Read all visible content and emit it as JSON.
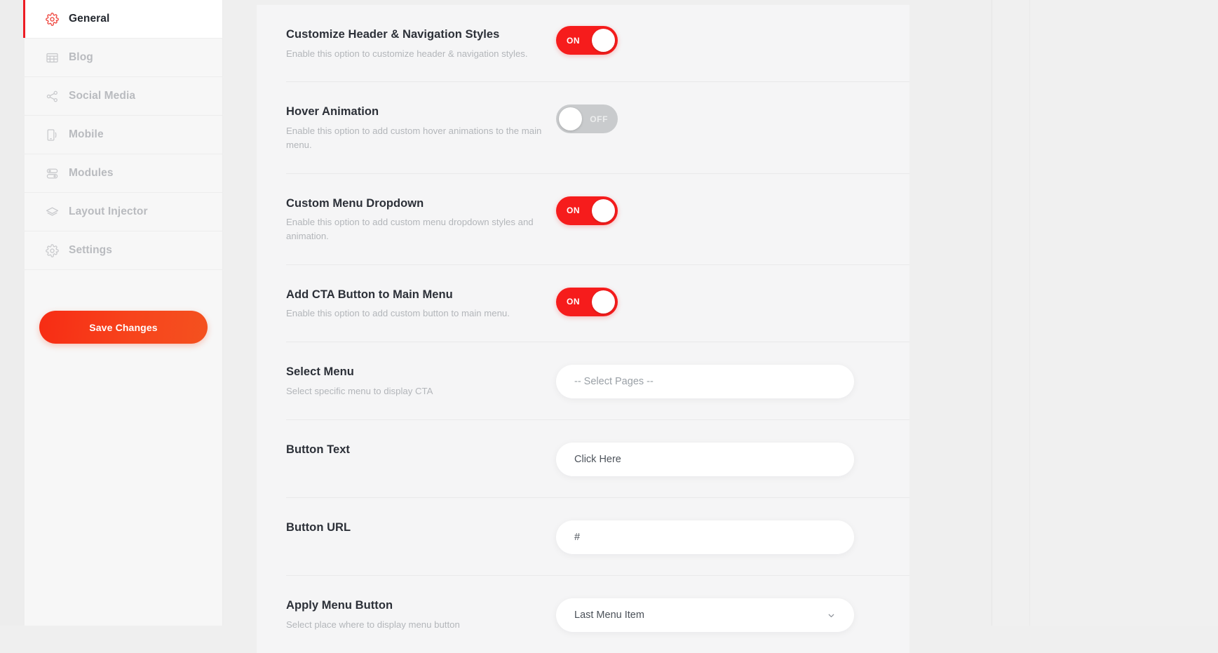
{
  "sidebar": {
    "items": [
      {
        "label": "General",
        "icon": "gear-icon",
        "active": true
      },
      {
        "label": "Blog",
        "icon": "blog-grid-icon",
        "active": false
      },
      {
        "label": "Social Media",
        "icon": "share-nodes-icon",
        "active": false
      },
      {
        "label": "Mobile",
        "icon": "mobile-device-icon",
        "active": false
      },
      {
        "label": "Modules",
        "icon": "modules-blocks-icon",
        "active": false
      },
      {
        "label": "Layout Injector",
        "icon": "layers-icon",
        "active": false
      },
      {
        "label": "Settings",
        "icon": "gear-icon",
        "active": false
      }
    ],
    "save_button": "Save Changes"
  },
  "colors": {
    "accent_red": "#f61c1c",
    "save_button_gradient_start": "#f72c14",
    "save_button_gradient_end": "#f4511f",
    "toggle_off_grey": "#c9cbcd",
    "active_indicator": "#ed1c24"
  },
  "settings": {
    "rows": [
      {
        "title": "Customize Header & Navigation Styles",
        "desc": "Enable this option to customize header & navigation styles.",
        "control": "toggle",
        "state": "ON"
      },
      {
        "title": "Hover Animation",
        "desc": "Enable this option to add custom hover animations to the main menu.",
        "control": "toggle",
        "state": "OFF"
      },
      {
        "title": "Custom Menu Dropdown",
        "desc": "Enable this option to add custom menu dropdown styles and animation.",
        "control": "toggle",
        "state": "ON"
      },
      {
        "title": "Add CTA Button to Main Menu",
        "desc": "Enable this option to add custom button to main menu.",
        "control": "toggle",
        "state": "ON"
      },
      {
        "title": "Select Menu",
        "desc": "Select specific menu to display CTA",
        "control": "select",
        "value": "-- Select Pages --"
      },
      {
        "title": "Button Text",
        "desc": "",
        "control": "input",
        "value": "Click Here",
        "placeholder": "Click Here"
      },
      {
        "title": "Button URL",
        "desc": "",
        "control": "input",
        "value": "#",
        "placeholder": "#"
      },
      {
        "title": "Apply Menu Button",
        "desc": "Select place where to display menu button",
        "control": "select-chevron",
        "value": "Last Menu Item"
      }
    ]
  }
}
